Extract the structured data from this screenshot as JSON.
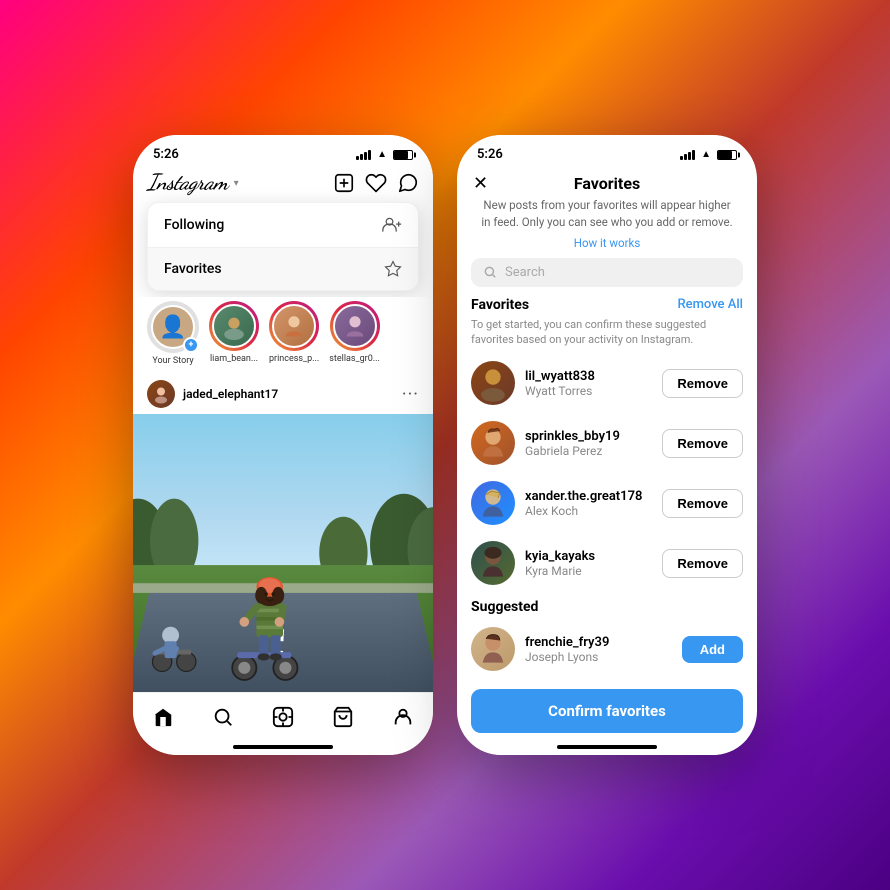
{
  "background": {
    "gradient": "linear-gradient(135deg, #ff0080 0%, #ff4500 20%, #ff8c00 35%, #c0392b 50%, #9b59b6 70%, #6a0dad 85%, #4b0082 100%)"
  },
  "phone1": {
    "status_time": "5:26",
    "header": {
      "logo": "Instagram",
      "chevron": "▾",
      "icons": [
        "+",
        "♡",
        "⊕"
      ]
    },
    "dropdown": {
      "items": [
        {
          "label": "Following",
          "icon": "👤+"
        },
        {
          "label": "Favorites",
          "icon": "☆"
        }
      ]
    },
    "stories": [
      {
        "label": "Your Story",
        "emoji": "➕"
      },
      {
        "label": "liam_bean...",
        "emoji": "🧑"
      },
      {
        "label": "princess_p...",
        "emoji": "👩"
      },
      {
        "label": "stellas_gr0...",
        "emoji": "👩"
      }
    ],
    "post": {
      "username": "jaded_elephant17",
      "more_icon": "···"
    },
    "nav": [
      "⌂",
      "🔍",
      "▶",
      "🛍",
      "👤"
    ]
  },
  "phone2": {
    "status_time": "5:26",
    "header_title": "Favorites",
    "close_icon": "✕",
    "subtitle": "New posts from your favorites will appear higher in feed. Only you can see who you add or remove.",
    "how_it_works": "How it works",
    "search_placeholder": "Search",
    "favorites_section": {
      "title": "Favorites",
      "remove_all": "Remove All",
      "description": "To get started, you can confirm these suggested favorites based on your activity on Instagram.",
      "users": [
        {
          "username": "lil_wyatt838",
          "real_name": "Wyatt Torres",
          "action": "Remove"
        },
        {
          "username": "sprinkles_bby19",
          "real_name": "Gabriela Perez",
          "action": "Remove"
        },
        {
          "username": "xander.the.great178",
          "real_name": "Alex Koch",
          "action": "Remove"
        },
        {
          "username": "kyia_kayaks",
          "real_name": "Kyra Marie",
          "action": "Remove"
        }
      ]
    },
    "suggested_section": {
      "title": "Suggested",
      "users": [
        {
          "username": "frenchie_fry39",
          "real_name": "Joseph Lyons",
          "action": "Add"
        }
      ]
    },
    "confirm_button": "Confirm favorites"
  }
}
